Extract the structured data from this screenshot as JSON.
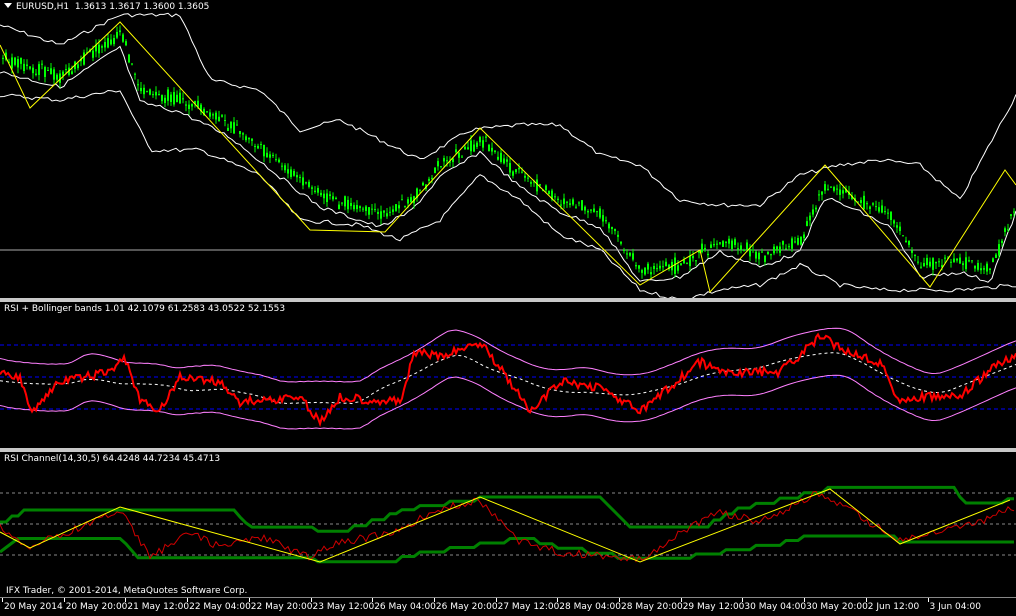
{
  "main_pane": {
    "title_prefix": "EURUSD,H1",
    "ohlc": "1.3613 1.3617 1.3600 1.3605"
  },
  "rsi_bb_pane": {
    "title": "RSI + Bollinger bands 1.01 42.1079 61.2583 43.0522 52.1553"
  },
  "rsi_channel_pane": {
    "title": "RSI Channel(14,30,5) 64.4248 44.7234 45.4713"
  },
  "footer": {
    "copyright": "IFX Trader, © 2001-2014, MetaQuotes Software Corp."
  },
  "time_axis": {
    "labels": [
      "20 May 2014",
      "20 May 20:00",
      "21 May 12:00",
      "22 May 04:00",
      "22 May 20:00",
      "23 May 12:00",
      "26 May 04:00",
      "26 May 20:00",
      "27 May 12:00",
      "28 May 04:00",
      "28 May 20:00",
      "29 May 12:00",
      "30 May 04:00",
      "30 May 20:00",
      "2 Jun 12:00",
      "3 Jun 04:00"
    ]
  },
  "colors": {
    "candle": "#00ff00",
    "bollinger": "#ffffff",
    "zigzag": "#ffff00",
    "rsi": "#ff0000",
    "rsi_band": "#ff80ff",
    "channel": "#008000",
    "level": "#0000ff"
  }
}
